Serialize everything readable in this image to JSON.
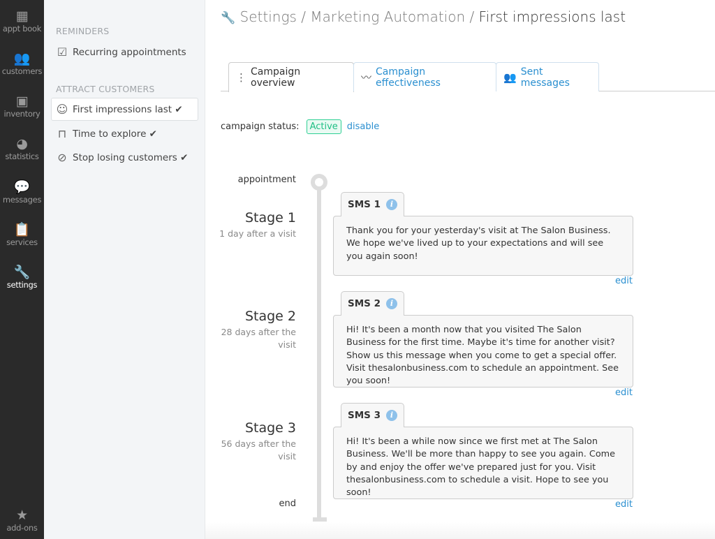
{
  "nav": [
    {
      "label": "appt book",
      "icon": "calendar-icon"
    },
    {
      "label": "customers",
      "icon": "users-icon"
    },
    {
      "label": "inventory",
      "icon": "box-icon"
    },
    {
      "label": "statistics",
      "icon": "pie-chart-icon"
    },
    {
      "label": "messages",
      "icon": "chat-icon"
    },
    {
      "label": "services",
      "icon": "clipboard-icon"
    },
    {
      "label": "settings",
      "icon": "wrench-icon",
      "active": true
    },
    {
      "label": "add-ons",
      "icon": "star-icon"
    }
  ],
  "subnav": {
    "reminders_title": "REMINDERS",
    "reminders": [
      {
        "label": "Recurring appointments",
        "icon": "clipboard-check-icon"
      }
    ],
    "attract_title": "ATTRACT CUSTOMERS",
    "attract": [
      {
        "label": "First impressions last ✔",
        "icon": "smiley-icon",
        "active": true
      },
      {
        "label": "Time to explore ✔",
        "icon": "shopping-bag-icon"
      },
      {
        "label": "Stop losing customers ✔",
        "icon": "compass-icon"
      }
    ]
  },
  "breadcrumb": {
    "part1": "Settings",
    "sep": " / ",
    "part2": "Marketing Automation",
    "current": "First impressions last"
  },
  "tabs": [
    {
      "label": "Campaign overview",
      "active": true
    },
    {
      "label": "Campaign effectiveness"
    },
    {
      "label": "Sent messages"
    }
  ],
  "status": {
    "label": "campaign status:",
    "value": "Active",
    "action": "disable"
  },
  "timeline": {
    "start": "appointment",
    "end": "end",
    "stages": [
      {
        "title": "Stage 1",
        "delay": "1 day after a visit",
        "sms": "SMS 1",
        "text": "Thank you for your yesterday's visit at The Salon Business. We hope we've lived up to your expectations and will see you again soon!",
        "edit": "edit"
      },
      {
        "title": "Stage 2",
        "delay": "28 days after the visit",
        "sms": "SMS 2",
        "text": "Hi! It's been a month now that you visited The Salon Business for the first time. Maybe it's time for another visit? Show us this message when you come to get a special offer. Visit thesalonbusiness.com to schedule an appointment. See you soon!",
        "edit": "edit"
      },
      {
        "title": "Stage 3",
        "delay": "56 days after the visit",
        "sms": "SMS 3",
        "text": "Hi! It's been a while now since we first met at The Salon Business. We'll be more than happy to see you again. Come by and enjoy the offer we've prepared just for you. Visit thesalonbusiness.com to schedule a visit. Hope to see you soon!",
        "edit": "edit"
      }
    ]
  },
  "colors": {
    "accent": "#2a8fd0",
    "active": "#1fbf84",
    "nav_bg": "#2a2a2a"
  }
}
